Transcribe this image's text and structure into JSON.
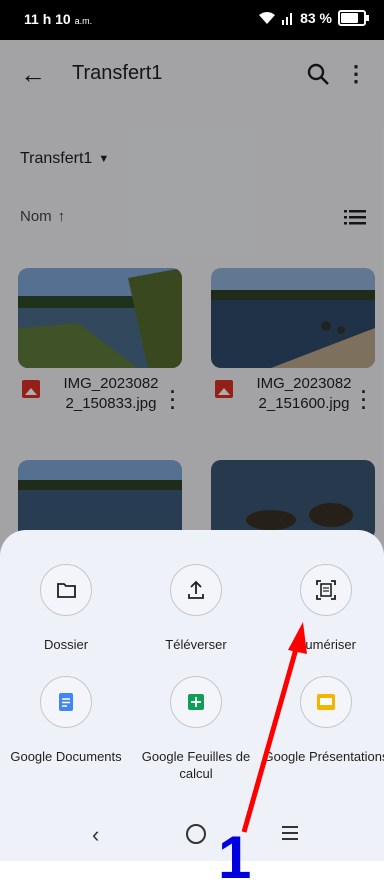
{
  "status_bar": {
    "time": "11 h 10",
    "time_suffix": "a.m.",
    "battery": "83 %",
    "battery_level": 0.83
  },
  "app_bar": {
    "title": "Transfert1",
    "back_icon": "arrow-back-icon",
    "search_icon": "search-icon",
    "more_icon": "more-vert-icon"
  },
  "folder_switcher": {
    "label": "Transfert1"
  },
  "sort": {
    "label": "Nom",
    "direction_icon": "arrow-up-icon",
    "view_icon": "list-view-icon"
  },
  "files": [
    {
      "name_line1": "IMG_2023082",
      "name_line2": "2_150833.jpg"
    },
    {
      "name_line1": "IMG_2023082",
      "name_line2": "2_151600.jpg"
    }
  ],
  "sheet_actions": [
    {
      "label": "Dossier",
      "icon": "folder-icon"
    },
    {
      "label": "Téléverser",
      "icon": "upload-icon"
    },
    {
      "label": "Numériser",
      "icon": "scan-icon"
    },
    {
      "label": "Google Documents",
      "icon": "google-docs-icon",
      "color": "#4285f4"
    },
    {
      "label": "Google Feuilles de calcul",
      "icon": "google-sheets-icon",
      "color": "#0f9d58"
    },
    {
      "label": "Google Présentations",
      "icon": "google-slides-icon",
      "color": "#f4b400"
    }
  ],
  "annotation": {
    "number": "1",
    "arrow_color": "#ff0000",
    "number_color": "#0000e0"
  }
}
